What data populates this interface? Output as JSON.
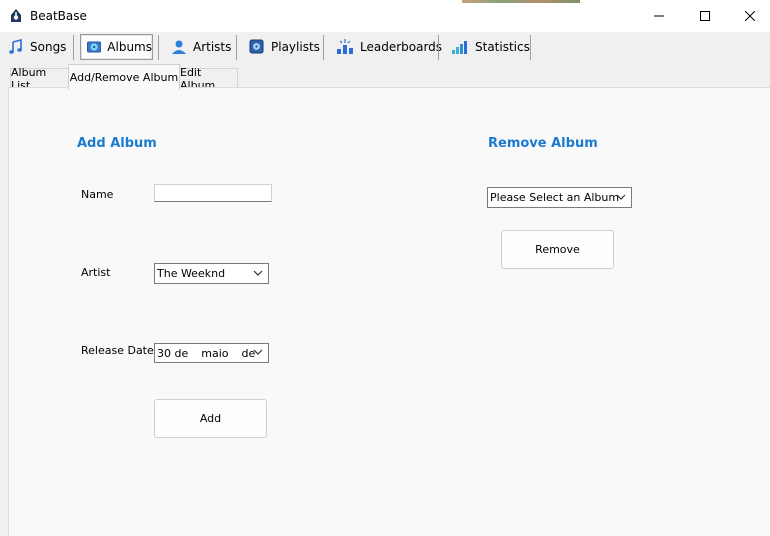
{
  "window": {
    "title": "BeatBase"
  },
  "toolbar": {
    "items": [
      {
        "label": "Songs",
        "icon": "music-note-icon"
      },
      {
        "label": "Albums",
        "icon": "album-icon",
        "active": true
      },
      {
        "label": "Artists",
        "icon": "artist-icon"
      },
      {
        "label": "Playlists",
        "icon": "playlist-icon"
      },
      {
        "label": "Leaderboards",
        "icon": "leaderboard-icon"
      },
      {
        "label": "Statistics",
        "icon": "statistics-icon"
      }
    ]
  },
  "tabs": [
    {
      "label": "Album List"
    },
    {
      "label": "Add/Remove Album",
      "active": true
    },
    {
      "label": "Edit Album"
    }
  ],
  "add_album": {
    "heading": "Add Album",
    "name_label": "Name",
    "name_value": "",
    "artist_label": "Artist",
    "artist_value": "The Weeknd",
    "release_label": "Release Date",
    "release_day": "30 de",
    "release_month": "maio",
    "release_sep": "de",
    "add_button": "Add"
  },
  "remove_album": {
    "heading": "Remove Album",
    "select_value": "Please Select an Album",
    "remove_button": "Remove"
  },
  "colors": {
    "accent": "#1c7bd1",
    "panel_bg": "#f9f9f9",
    "chrome_bg": "#f0f0f0"
  }
}
